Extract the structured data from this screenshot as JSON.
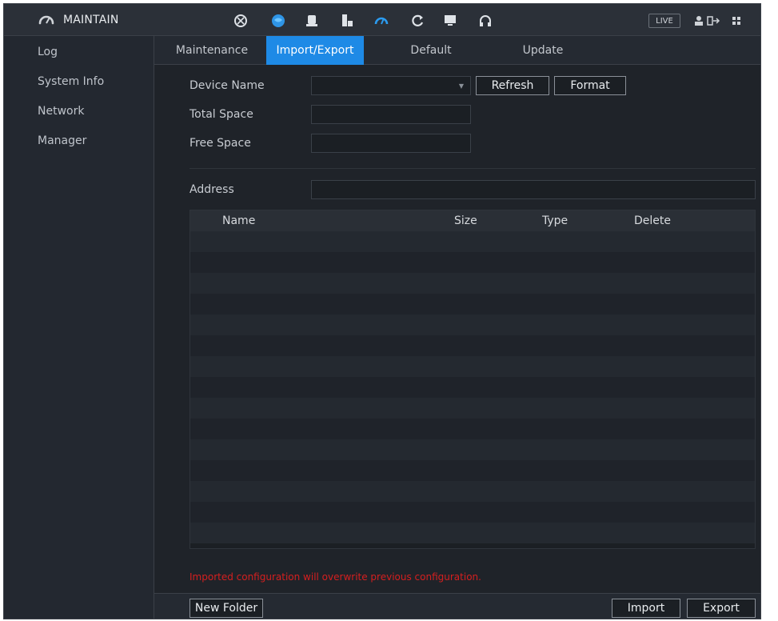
{
  "topbar": {
    "title": "MAINTAIN",
    "live_label": "LIVE",
    "icons": [
      "camera-icon",
      "network-icon",
      "storage-icon",
      "account-icon",
      "maintain-icon",
      "backup-icon",
      "display-icon",
      "audio-icon",
      "user-icon",
      "logout-icon",
      "grid-icon"
    ],
    "accent_color": "#1e8ae6"
  },
  "sidebar": {
    "items": [
      {
        "label": "Log"
      },
      {
        "label": "System Info"
      },
      {
        "label": "Network"
      },
      {
        "label": "Manager"
      }
    ]
  },
  "tabs": [
    {
      "label": "Maintenance",
      "active": false
    },
    {
      "label": "Import/Export",
      "active": true
    },
    {
      "label": "Default",
      "active": false
    },
    {
      "label": "Update",
      "active": false
    }
  ],
  "form": {
    "device_name_label": "Device Name",
    "device_name_value": "",
    "refresh_label": "Refresh",
    "format_label": "Format",
    "total_space_label": "Total Space",
    "total_space_value": "",
    "free_space_label": "Free Space",
    "free_space_value": "",
    "address_label": "Address",
    "address_value": ""
  },
  "table": {
    "columns": [
      "Name",
      "Size",
      "Type",
      "Delete"
    ],
    "rows": []
  },
  "warning_text": "Imported configuration will overwrite previous configuration.",
  "bottom": {
    "new_folder_label": "New Folder",
    "import_label": "Import",
    "export_label": "Export"
  }
}
